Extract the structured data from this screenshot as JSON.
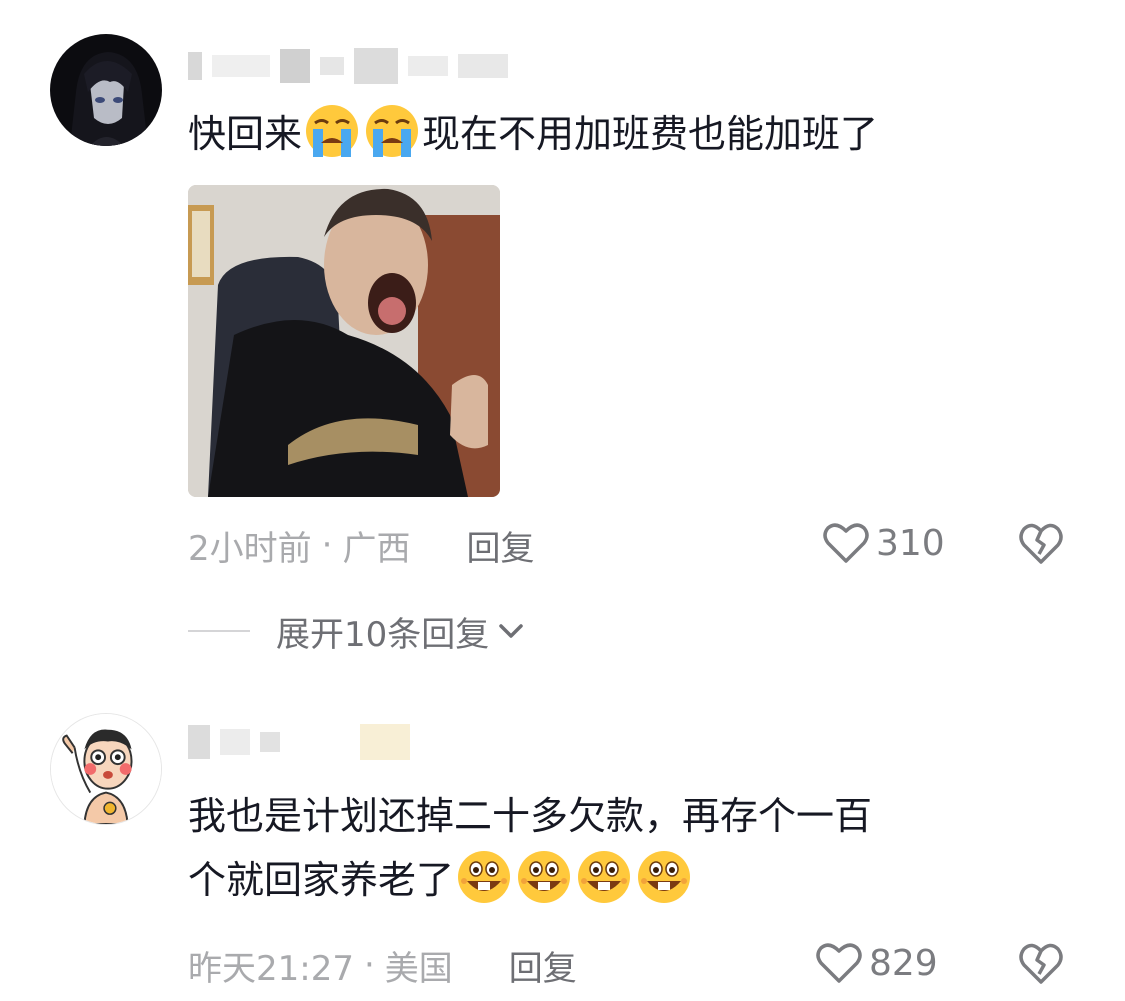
{
  "comments": [
    {
      "text": "快回来",
      "text_after": "现在不用加班费也能加班了",
      "emojis": [
        "loudly-crying-emoji",
        "loudly-crying-emoji"
      ],
      "time": "2小时前",
      "separator": "·",
      "location": "广西",
      "reply_label": "回复",
      "likes": "310"
    },
    {
      "text_line1": "我也是计划还掉二十多欠款，再存个一百",
      "text_line2": "个就回家养老了",
      "emojis": [
        "grinning-teeth-emoji",
        "grinning-teeth-emoji",
        "grinning-teeth-emoji",
        "grinning-teeth-emoji"
      ],
      "time": "昨天21:27",
      "separator": "·",
      "location": "美国",
      "reply_label": "回复",
      "likes": "829"
    }
  ],
  "expand_replies": {
    "label": "展开10条回复"
  },
  "colors": {
    "text": "#161823",
    "meta": "#a9aaad",
    "reply": "#6e6f74"
  }
}
